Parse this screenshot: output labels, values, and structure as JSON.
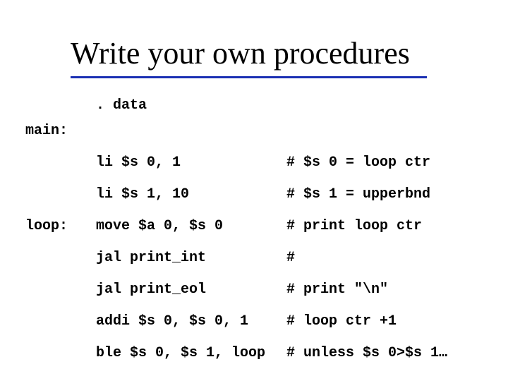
{
  "title": "Write your own procedures",
  "rows": [
    {
      "label": "",
      "instr": ". data",
      "comment": ""
    },
    {
      "label": "main:",
      "instr": "",
      "comment": ""
    },
    {
      "label": "",
      "instr": "li $s 0, 1",
      "comment": "# $s 0 = loop ctr"
    },
    {
      "label": "",
      "instr": "li $s 1, 10",
      "comment": "# $s 1 = upperbnd"
    },
    {
      "label": "loop:",
      "instr": "move $a 0, $s 0",
      "comment": "# print loop ctr"
    },
    {
      "label": "",
      "instr": "jal print_int",
      "comment": "#"
    },
    {
      "label": "",
      "instr": "jal print_eol",
      "comment": "# print \"\\n\""
    },
    {
      "label": "",
      "instr": "addi $s 0, $s 0, 1",
      "comment": "# loop ctr +1"
    },
    {
      "label": "",
      "instr": "ble $s 0, $s 1, loop",
      "comment": "# unless $s 0>$s 1…"
    }
  ]
}
